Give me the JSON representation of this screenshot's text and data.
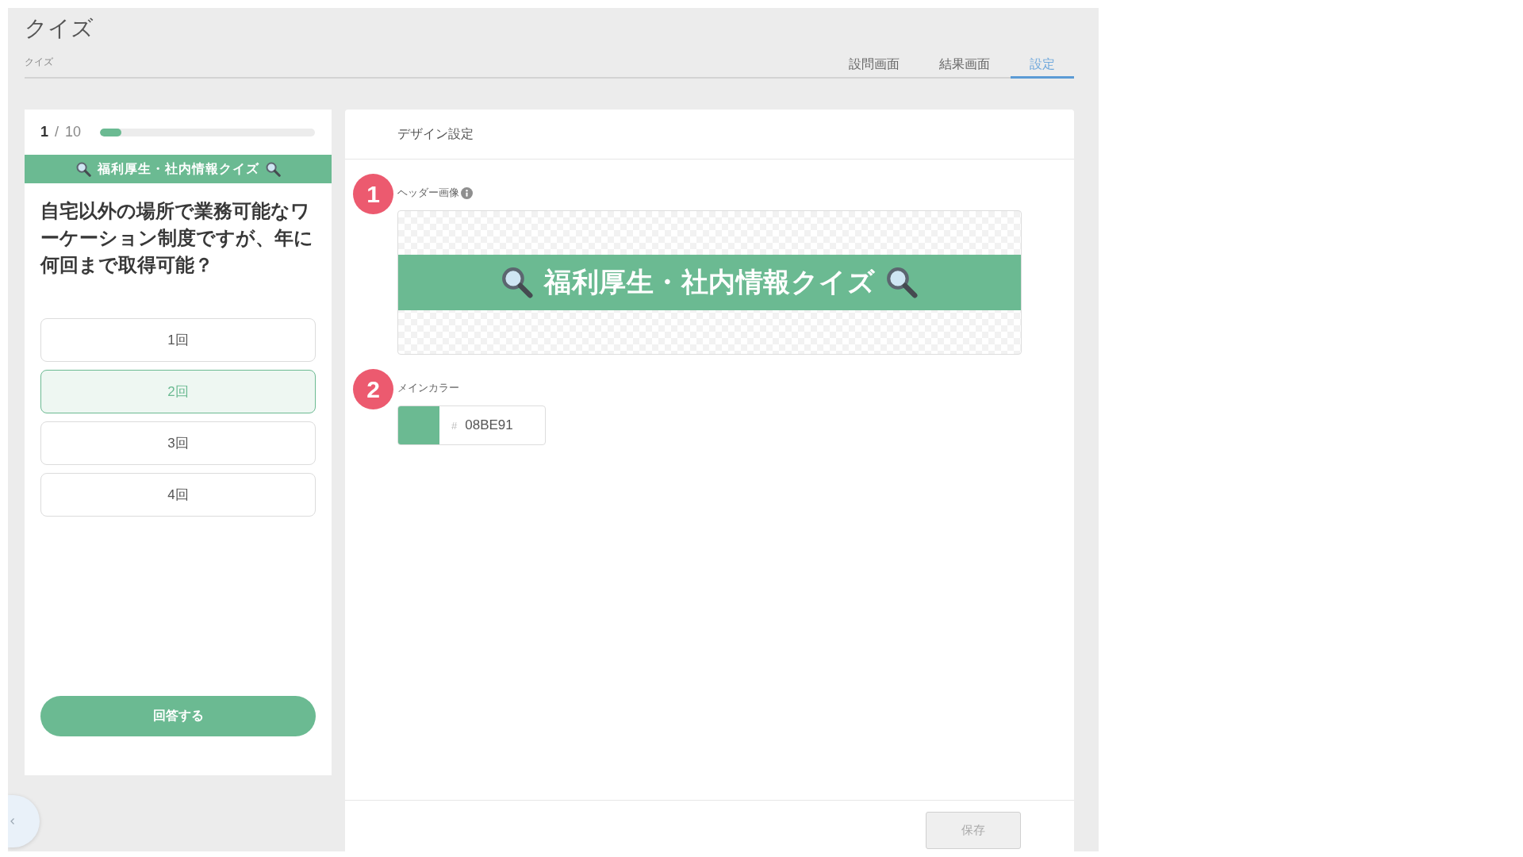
{
  "page": {
    "title": "クイズ",
    "breadcrumb": "クイズ"
  },
  "tabs": [
    {
      "label": "設問画面",
      "selected": false
    },
    {
      "label": "結果画面",
      "selected": false
    },
    {
      "label": "設定",
      "selected": true
    }
  ],
  "preview": {
    "progress_text": "**1** / 10",
    "level": 0.1,
    "banner_title": "福利厚生・社内情報クイズ",
    "question": "自宅以外の場所で業務可能なワーケーション制度ですが、年に何回まで取得可能？",
    "choices": [
      {
        "label": "1回",
        "selected": false
      },
      {
        "label": "2回",
        "selected": true
      },
      {
        "label": "3回",
        "selected": false
      },
      {
        "label": "4回",
        "selected": false
      }
    ],
    "submit_button": "回答する"
  },
  "settings": {
    "heading": "デザイン設定",
    "fields": [
      {
        "kind": "image",
        "badge": "1",
        "label": "ヘッダー画像",
        "info": true,
        "image_title": "福利厚生・社内情報クイズ"
      },
      {
        "kind": "color",
        "badge": "2",
        "label": "メインカラー",
        "info": false,
        "prefix": "#",
        "value": "08BE91",
        "color": "#6bba92"
      }
    ],
    "save_button": {
      "label": "保存",
      "disabled": true
    }
  }
}
